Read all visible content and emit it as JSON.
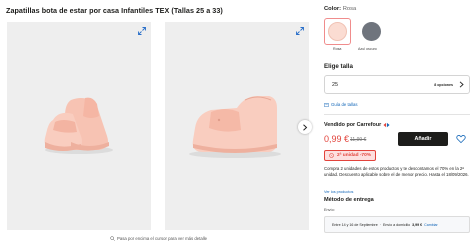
{
  "product": {
    "title": "Zapatillas bota de estar por casa Infantiles TEX (Tallas 25 a 33)"
  },
  "gallery": {
    "zoom_hint": "Pasa por encima el cursor para ver más detalle"
  },
  "color": {
    "label": "Color:",
    "selected": "Rosa",
    "swatches": [
      {
        "name": "Rosa",
        "hex": "#fbdcd2"
      },
      {
        "name": "Azul oscuro",
        "hex": "#6f747d"
      }
    ]
  },
  "size": {
    "title": "Elige talla",
    "value": "25",
    "options_count": "8 opciones",
    "guide_link": "Guía de tallas"
  },
  "seller": {
    "label": "Vendido por Carrefour"
  },
  "price": {
    "current": "0,99 €",
    "old": "11,99 €",
    "add_button": "Añadir"
  },
  "promo": {
    "badge": "2ª unidad -70%",
    "text": "Compra 2 unidades de estos productos y te descontamos el 70% en la 2ª unidad. Descuento aplicable sobre el de menor precio. Hasta el 18/09/2026.",
    "link": "Ver los productos"
  },
  "delivery": {
    "title": "Método de entrega",
    "send_label": "Envío:",
    "dates": "Entre 14 y 16 de Septiembre",
    "home_label": "Envío a domicilio",
    "cost": "3,99 €",
    "change_link": "Cambiar"
  },
  "colors": {
    "accent_red": "#e2433b",
    "link_blue": "#1266b8",
    "dark_button": "#1d1d1b"
  }
}
